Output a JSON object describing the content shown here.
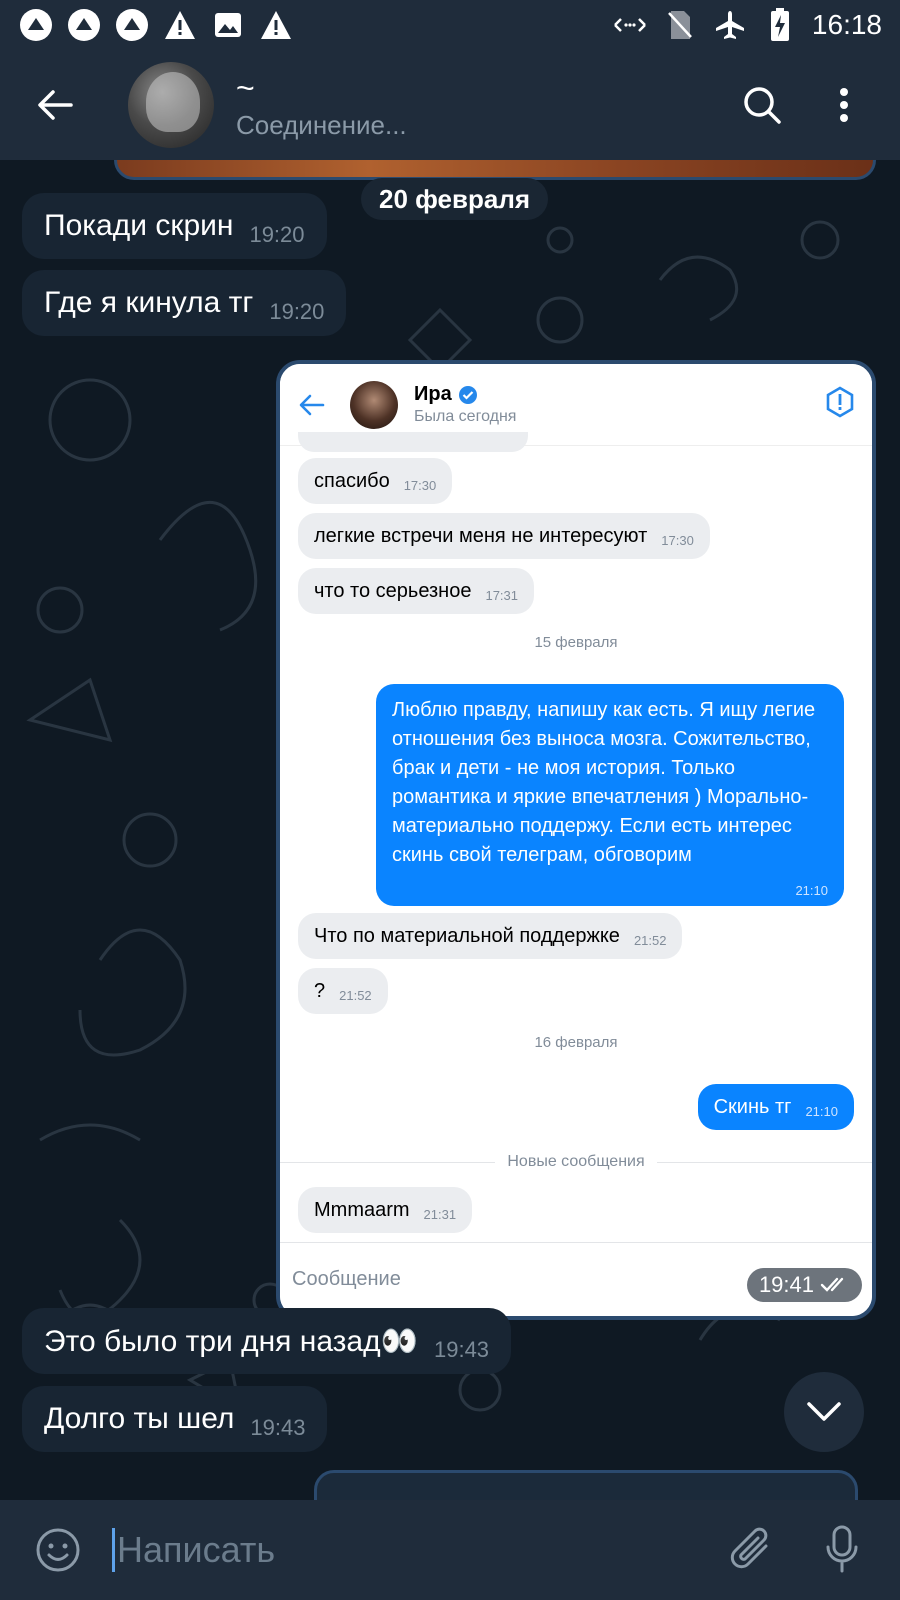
{
  "status_bar": {
    "time": "16:18",
    "left_icons": [
      "app-icon",
      "app-icon",
      "app-icon",
      "warning-icon",
      "image-icon",
      "warning-icon"
    ],
    "right_icons": [
      "data-arrows-icon",
      "no-sim-icon",
      "airplane-icon",
      "battery-charging-icon"
    ]
  },
  "header": {
    "title": "~",
    "subtitle": "Соединение..."
  },
  "chat": {
    "date_label": "20 февраля",
    "messages_top": [
      {
        "text": "Покади скрин",
        "time": "19:20"
      },
      {
        "text": "Где я кинула тг",
        "time": "19:20"
      }
    ],
    "screenshot_time": "19:41",
    "messages_bottom": [
      {
        "text": "Это было три дня назад👀",
        "time": "19:43"
      },
      {
        "text": "Долго ты шел",
        "time": "19:43"
      }
    ]
  },
  "screenshot": {
    "contact_name": "Ира",
    "contact_status": "Была сегодня",
    "messages": [
      {
        "dir": "in",
        "text": "спасибо",
        "time": "17:30"
      },
      {
        "dir": "in",
        "text": "легкие встречи меня не интересуют",
        "time": "17:30"
      },
      {
        "dir": "in",
        "text": "что то серьезное",
        "time": "17:31"
      }
    ],
    "date_1": "15 февраля",
    "out_long": {
      "text": "Люблю правду, напишу как есть. Я ищу легие отношения без выноса мозга. Сожительство, брак и дети - не моя история. Только романтика и яркие впечатления ) Морально-материально поддержу. Если есть интерес скинь свой телеграм, обговорим",
      "time": "21:10"
    },
    "messages_2": [
      {
        "dir": "in",
        "text": "Что по материальной поддержке",
        "time": "21:52"
      },
      {
        "dir": "in",
        "text": "?",
        "time": "21:52"
      }
    ],
    "date_2": "16 февраля",
    "out_short": {
      "text": "Скинь тг",
      "time": "21:10"
    },
    "new_messages_label": "Новые сообщения",
    "last_in": {
      "text": "Mmmaarm",
      "time": "21:31"
    },
    "input_placeholder": "Сообщение"
  },
  "input": {
    "placeholder": "Написать"
  },
  "colors": {
    "header_bg": "#1f2c3b",
    "chat_bg": "#0f1923",
    "bubble_in": "#182533",
    "vk_blue": "#0a84ff"
  }
}
